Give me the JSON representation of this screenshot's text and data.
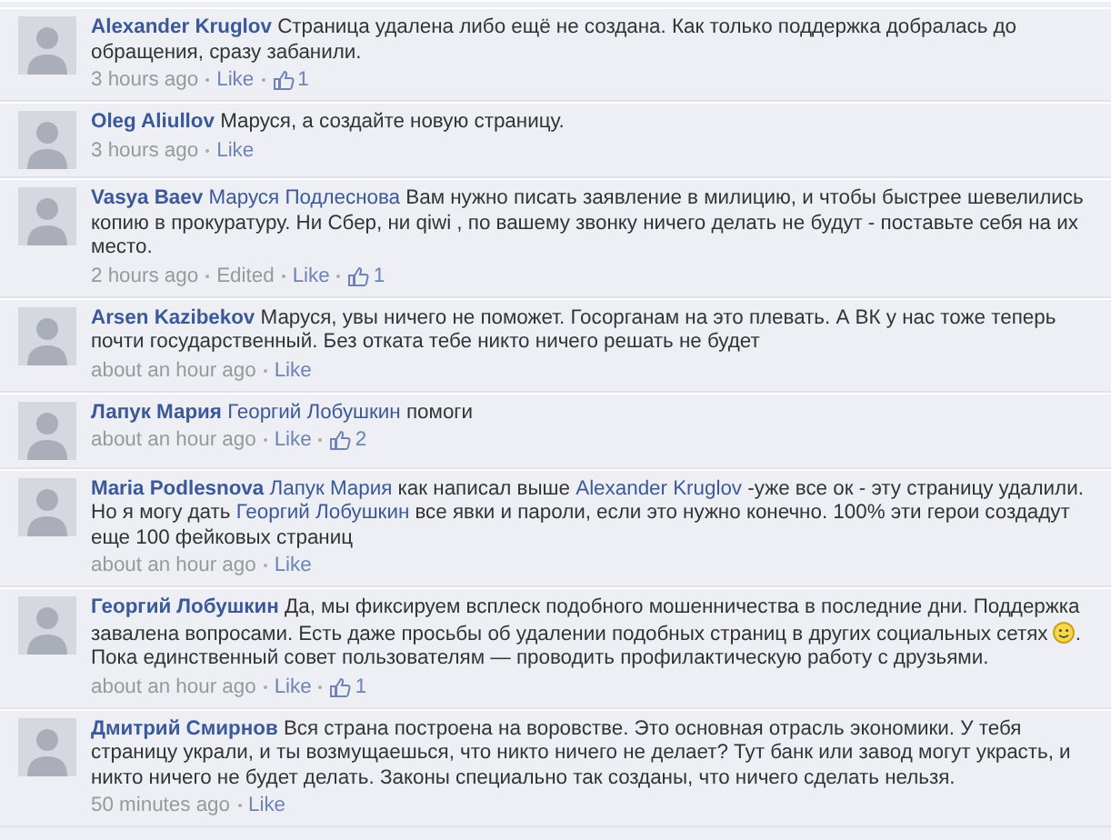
{
  "comments": [
    {
      "author": "Alexander Kruglov",
      "body": [
        {
          "kind": "text",
          "text": "Страница удалена либо ещё не создана. Как только поддержка добралась до обращения, сразу забанили."
        }
      ],
      "time": "3 hours ago",
      "like": "Like",
      "likes": "1"
    },
    {
      "author": "Oleg Aliullov",
      "body": [
        {
          "kind": "text",
          "text": "Маруся, а создайте новую страницу."
        }
      ],
      "time": "3 hours ago",
      "like": "Like"
    },
    {
      "author": "Vasya Baev",
      "body": [
        {
          "kind": "mention",
          "text": "Маруся Подлеснова"
        },
        {
          "kind": "text",
          "text": " Вам нужно писать заявление в милицию, и чтобы быстрее шевелились копию в прокуратуру. Ни Сбер, ни qiwi , по вашему звонку ничего делать не будут - поставьте себя на их место."
        }
      ],
      "time": "2 hours ago",
      "edited": "Edited",
      "like": "Like",
      "likes": "1"
    },
    {
      "author": "Arsen Kazibekov",
      "body": [
        {
          "kind": "text",
          "text": "Маруся, увы ничего не поможет. Госорганам на это плевать. А ВК у нас тоже теперь почти государственный. Без отката тебе никто ничего решать не будет"
        }
      ],
      "time": "about an hour ago",
      "like": "Like"
    },
    {
      "author": "Лапук Мария",
      "body": [
        {
          "kind": "mention",
          "text": "Георгий Лобушкин"
        },
        {
          "kind": "text",
          "text": " помоги"
        }
      ],
      "time": "about an hour ago",
      "like": "Like",
      "likes": "2"
    },
    {
      "author": "Maria Podlesnova",
      "body": [
        {
          "kind": "mention",
          "text": "Лапук Мария"
        },
        {
          "kind": "text",
          "text": " как написал выше "
        },
        {
          "kind": "mention",
          "text": "Alexander Kruglov"
        },
        {
          "kind": "text",
          "text": " -уже все ок - эту страницу удалили. Но я могу дать "
        },
        {
          "kind": "mention",
          "text": "Георгий Лобушкин"
        },
        {
          "kind": "text",
          "text": " все явки и пароли, если это нужно конечно.  100% эти герои создадут еще 100 фейковых страниц"
        }
      ],
      "time": "about an hour ago",
      "like": "Like"
    },
    {
      "author": "Георгий Лобушкин",
      "body": [
        {
          "kind": "text",
          "text": "Да, мы фиксируем всплеск подобного мошенничества в последние дни. Поддержка завалена вопросами. Есть даже просьбы об удалении подобных страниц в других социальных сетях "
        },
        {
          "kind": "emoticon"
        },
        {
          "kind": "text",
          "text": ". Пока единственный совет пользователям — проводить профилактическую работу с друзьями."
        }
      ],
      "time": "about an hour ago",
      "like": "Like",
      "likes": "1"
    },
    {
      "author": "Дмитрий Смирнов",
      "body": [
        {
          "kind": "text",
          "text": "Вся страна построена на воровстве. Это основная отрасль экономики. У тебя страницу украли, и ты возмущаешься, что никто ничего не делает? Тут банк или завод могут украсть, и никто ничего не будет делать. Законы специально так созданы, что ничего сделать нельзя."
        }
      ],
      "time": "50 minutes ago",
      "like": "Like"
    }
  ]
}
